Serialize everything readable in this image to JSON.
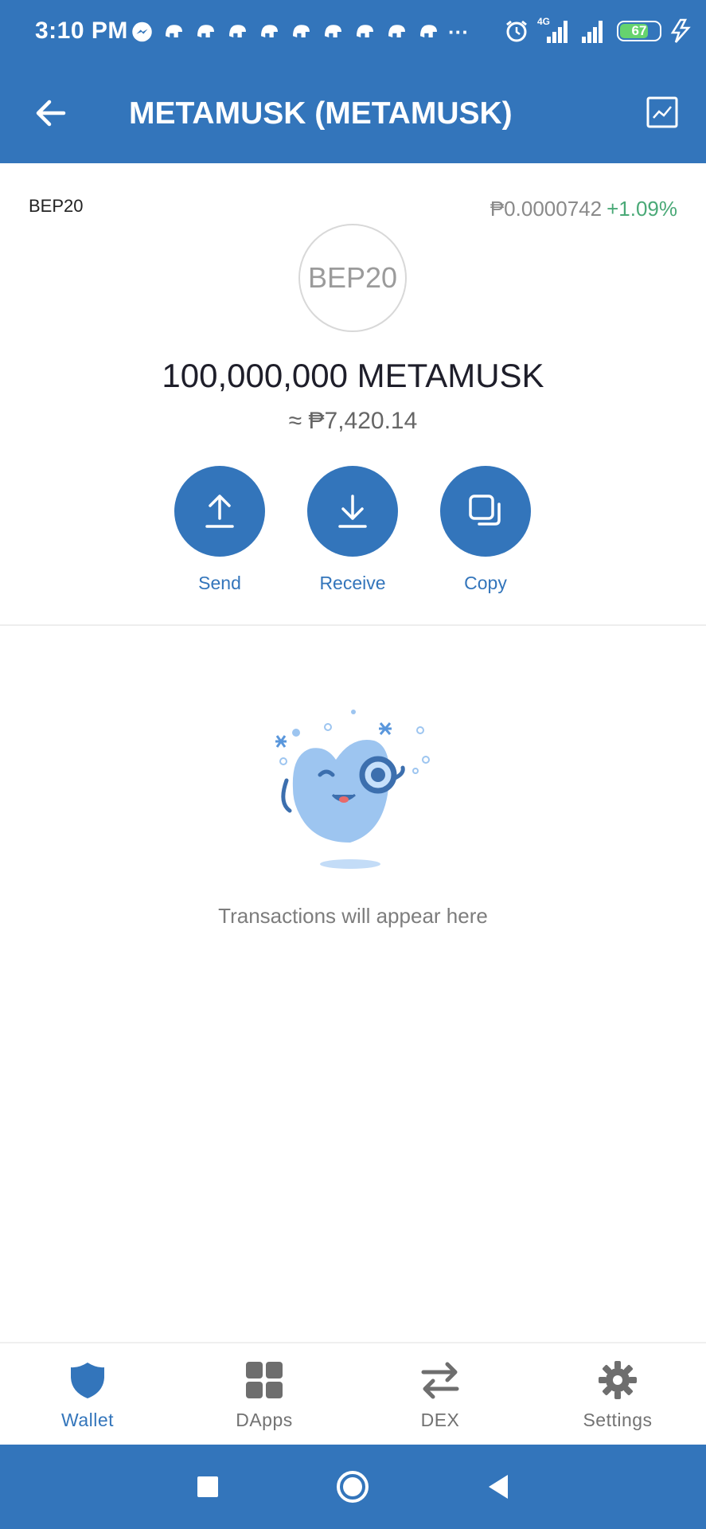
{
  "status_bar": {
    "time": "3:10 PM",
    "notification_icons": [
      "messenger-icon",
      "notification-icon",
      "notification-icon",
      "notification-icon",
      "notification-icon",
      "notification-icon",
      "notification-icon",
      "notification-icon",
      "notification-icon",
      "notification-icon"
    ],
    "overflow": "···",
    "network_type": "4G",
    "battery_level": "67"
  },
  "header": {
    "title": "METAMUSK (METAMUSK)",
    "back_icon": "arrow-left-icon",
    "chart_icon": "chart-icon"
  },
  "token": {
    "network": "BEP20",
    "price": "₱0.0000742",
    "change": "+1.09%",
    "logo_text": "BEP20",
    "balance": "100,000,000 METAMUSK",
    "fiat_value": "≈ ₱7,420.14"
  },
  "actions": [
    {
      "label": "Send",
      "icon": "upload-icon"
    },
    {
      "label": "Receive",
      "icon": "download-icon"
    },
    {
      "label": "Copy",
      "icon": "copy-icon"
    }
  ],
  "empty_state": {
    "text": "Transactions will appear here"
  },
  "tabs": [
    {
      "label": "Wallet",
      "icon": "shield-icon",
      "active": true
    },
    {
      "label": "DApps",
      "icon": "grid-icon",
      "active": false
    },
    {
      "label": "DEX",
      "icon": "swap-icon",
      "active": false
    },
    {
      "label": "Settings",
      "icon": "gear-icon",
      "active": false
    }
  ],
  "colors": {
    "primary": "#3375bb",
    "positive": "#4aa977",
    "tab_inactive": "#727272"
  }
}
